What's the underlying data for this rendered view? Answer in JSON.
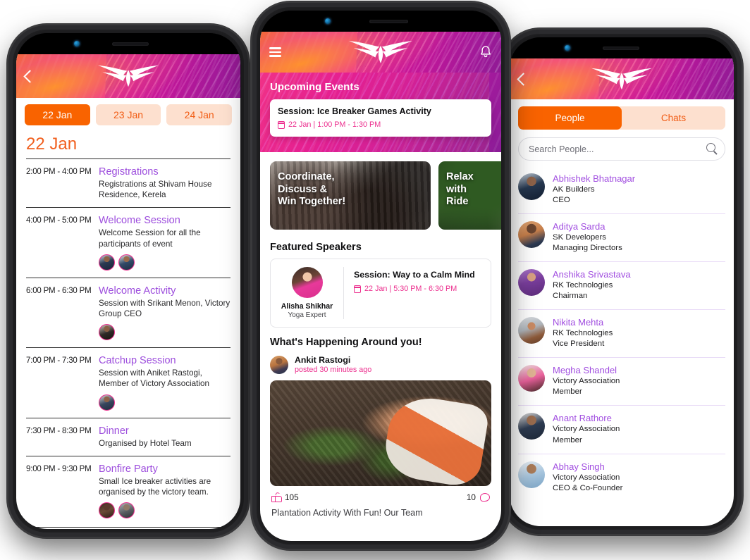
{
  "brand": {
    "logo_name": "victory-wings-logo",
    "accent_orange": "#f96300",
    "accent_pink": "#ec2f8e",
    "accent_purple": "#a14ee0"
  },
  "agenda_phone": {
    "header": {
      "back_icon": "back-chevron-icon",
      "logo": "victory-wings-logo"
    },
    "day_tabs": [
      {
        "label": "22 Jan",
        "active": true
      },
      {
        "label": "23 Jan",
        "active": false
      },
      {
        "label": "24 Jan",
        "active": false
      }
    ],
    "day_title": "22 Jan",
    "sessions": [
      {
        "time": "2:00 PM - 4:00 PM",
        "title": "Registrations",
        "desc": "Registrations at Shivam House Residence, Kerela",
        "avatars": []
      },
      {
        "time": "4:00 PM - 5:00 PM",
        "title": "Welcome Session",
        "desc": "Welcome Session for all the participants of event",
        "avatars": [
          "avatar-1",
          "avatar-2"
        ]
      },
      {
        "time": "6:00 PM - 6:30 PM",
        "title": "Welcome Activity",
        "desc": "Session with Srikant Menon, Victory Group CEO",
        "avatars": [
          "avatar-3"
        ]
      },
      {
        "time": "7:00 PM - 7:30 PM",
        "title": "Catchup Session",
        "desc": "Session with Aniket Rastogi, Member of Victory Association",
        "avatars": [
          "avatar-4"
        ]
      },
      {
        "time": "7:30 PM - 8:30 PM",
        "title": "Dinner",
        "desc": "Organised by Hotel Team",
        "avatars": []
      },
      {
        "time": "9:00 PM - 9:30 PM",
        "title": "Bonfire Party",
        "desc": "Small Ice breaker activities are organised by the victory team.",
        "avatars": [
          "avatar-5",
          "avatar-6"
        ]
      }
    ]
  },
  "home_phone": {
    "header": {
      "menu_icon": "hamburger-menu-icon",
      "logo": "victory-wings-logo",
      "bell_icon": "notification-bell-icon"
    },
    "upcoming": {
      "heading": "Upcoming Events",
      "card": {
        "title": "Session: Ice Breaker Games Activity",
        "meta": "22 Jan | 1:00 PM - 1:30 PM",
        "icon": "calendar-icon"
      }
    },
    "promos": [
      {
        "text": "Coordinate,\nDiscuss &\nWin Together!",
        "image": "group-meeting-photo"
      },
      {
        "text": "Relax\nwith\nRide",
        "image": "nature-resort-photo"
      }
    ],
    "speakers": {
      "heading": "Featured Speakers",
      "items": [
        {
          "name": "Alisha Shikhar",
          "role": "Yoga Expert",
          "session_title": "Session: Way to a Calm Mind",
          "session_meta": "22 Jan | 5:30 PM - 6:30 PM"
        }
      ]
    },
    "feed": {
      "heading": "What's Happening Around you!",
      "posts": [
        {
          "author": "Ankit Rastogi",
          "time": "posted 30 minutes ago",
          "image": "plantation-gardening-photo",
          "likes": "105",
          "comments": "10",
          "caption": "Plantation Activity With Fun! Our Team"
        }
      ]
    }
  },
  "people_phone": {
    "header": {
      "back_icon": "back-chevron-icon",
      "logo": "victory-wings-logo"
    },
    "tabs": [
      {
        "label": "People",
        "active": true
      },
      {
        "label": "Chats",
        "active": false
      }
    ],
    "search": {
      "placeholder": "Search People...",
      "value": "",
      "icon": "search-icon"
    },
    "people": [
      {
        "name": "Abhishek Bhatnagar",
        "company": "AK Builders",
        "role": "CEO"
      },
      {
        "name": "Aditya Sarda",
        "company": "SK Developers",
        "role": "Managing Directors"
      },
      {
        "name": "Anshika Srivastava",
        "company": "RK Technologies",
        "role": "Chairman"
      },
      {
        "name": "Nikita Mehta",
        "company": "RK Technologies",
        "role": "Vice President"
      },
      {
        "name": "Megha Shandel",
        "company": "Victory Association",
        "role": "Member"
      },
      {
        "name": "Anant Rathore",
        "company": "Victory Association",
        "role": "Member"
      },
      {
        "name": "Abhay Singh",
        "company": "Victory Association",
        "role": "CEO & Co-Founder"
      }
    ]
  }
}
